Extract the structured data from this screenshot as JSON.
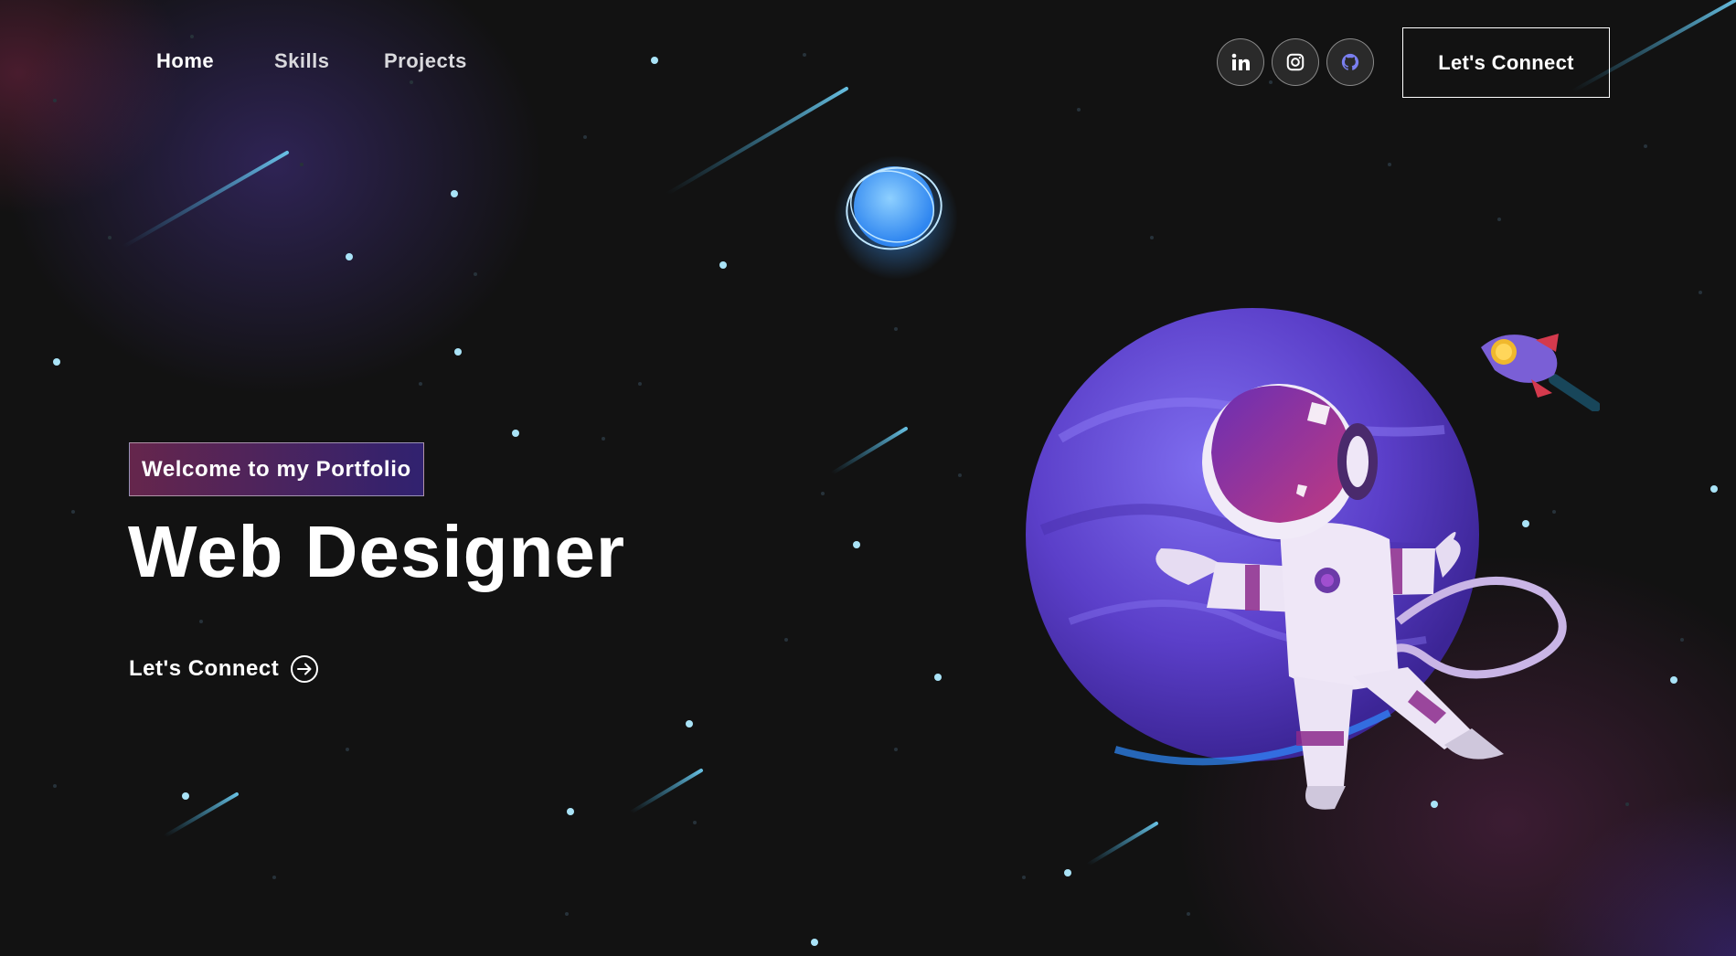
{
  "nav": {
    "links": [
      {
        "label": "Home",
        "active": true
      },
      {
        "label": "Skills",
        "active": false
      },
      {
        "label": "Projects",
        "active": false
      }
    ],
    "social": [
      {
        "icon": "linkedin-icon"
      },
      {
        "icon": "instagram-icon"
      },
      {
        "icon": "github-icon"
      }
    ],
    "connect_label": "Let's Connect"
  },
  "hero": {
    "tagline": "Welcome to my Portfolio",
    "headline": "Web Designer",
    "cta_label": "Let's Connect",
    "cta_icon": "arrow-right-circle-icon"
  },
  "illustration": {
    "items": [
      "astronaut",
      "purple-planet",
      "blue-planet",
      "rocket",
      "shooting-stars"
    ]
  },
  "colors": {
    "background": "#121212",
    "accent_pink": "#AA367C",
    "accent_purple": "#4A2FBD",
    "text": "#FFFFFF"
  }
}
